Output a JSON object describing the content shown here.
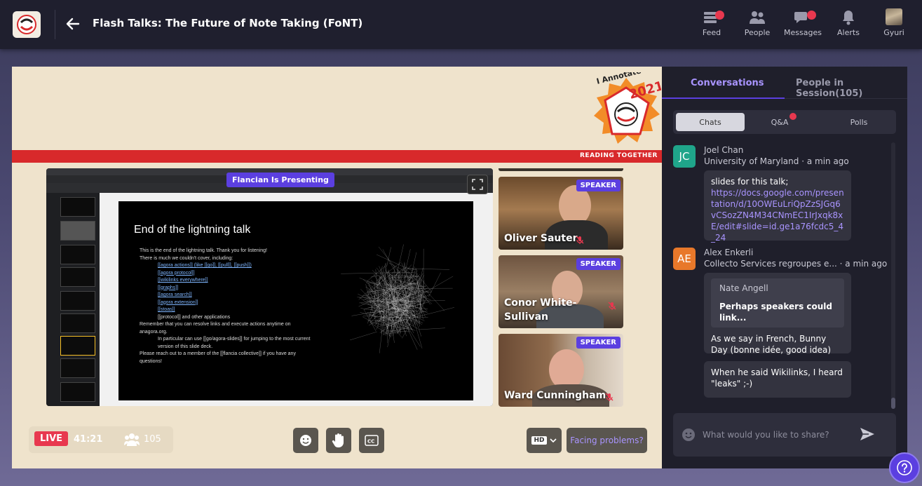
{
  "header": {
    "title": "Flash Talks: The Future of Note Taking (FoNT)",
    "nav": [
      {
        "label": "Feed",
        "icon": "feed-icon"
      },
      {
        "label": "People",
        "icon": "people-icon"
      },
      {
        "label": "Messages",
        "icon": "messages-icon"
      },
      {
        "label": "Alerts",
        "icon": "bell-icon"
      },
      {
        "label": "Gyuri",
        "icon": "avatar"
      }
    ]
  },
  "stage": {
    "badge_year": "2021",
    "badge_name": "I Annotate",
    "banner": "READING TOGETHER",
    "presenting": "Flancian Is Presenting",
    "slide": {
      "title": "End of the lightning talk",
      "bullets": [
        "This is the end of the lightning talk. Thank you for listening!",
        "There is much we couldn't cover, including:",
        "[[agora actions]] (like [[go]], [[pull]], [[push]])",
        "[[agora protocol]]",
        "[[wikilinks everywhere]]",
        "[[graphs]]",
        "[[agora search]]",
        "[[agora extension]]",
        "[[stoas]]",
        "[[protocol]] and other applications",
        "Remember that you can resolve links and execute actions anytime on anagora.org.",
        "In particular can use [[go/agora-slides]] for jumping to the most current version of this slide deck.",
        "Please reach out to a member of the [[flancia collective]] if you have any questions!"
      ]
    },
    "speakers": [
      {
        "name": "Oliver Sauter",
        "badge": "SPEAKER"
      },
      {
        "name": "Conor White-Sullivan",
        "badge": "SPEAKER"
      },
      {
        "name": "Ward Cunningham",
        "badge": "SPEAKER"
      }
    ],
    "live_label": "LIVE",
    "timer": "41:21",
    "attendees": "105",
    "hd_label": "HD",
    "facing_problems": "Facing problems?"
  },
  "panel": {
    "tabs": [
      "Conversations",
      "People in Session(105)"
    ],
    "segments": [
      "Chats",
      "Q&A",
      "Polls"
    ],
    "messages": [
      {
        "initials": "JC",
        "name": "Joel Chan",
        "org": "University of Maryland",
        "time": "a min ago",
        "text": "slides for this talk;",
        "url": "https://docs.google.com/presentation/d/10OWEuLriQpZzSJGq6vCSozZN4M34CNmEC1IrJxqk8xE/edit#slide=id.ge1a76fcdc5_4_24"
      },
      {
        "initials": "AE",
        "name": "Alex Enkerli",
        "org": "Collecto Services regroupes e...",
        "time": "a min ago",
        "quote_name": "Nate Angell",
        "quote_text": "Perhaps speakers could link...",
        "text": "As we say in French, Bunny Day (bonne idée, good idea)",
        "text2": "When he said Wikilinks, I heard \"leaks\" ;-)"
      }
    ],
    "input_placeholder": "What would you like to share?"
  },
  "colors": {
    "accent": "#5b3fe0",
    "live": "#e8384f",
    "banner_red": "#d8292b",
    "stage_bg": "#efe3cc"
  }
}
